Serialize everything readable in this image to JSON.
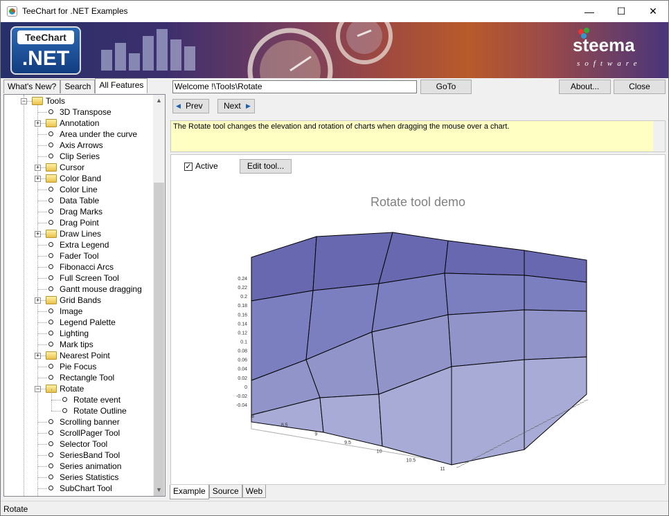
{
  "window": {
    "title": "TeeChart for .NET Examples",
    "controls": {
      "minimize": "—",
      "maximize": "☐",
      "close": "✕"
    }
  },
  "banner": {
    "logo_top": "TeeChart",
    "logo_bottom": ".NET",
    "brand": "steema",
    "brand_sub": "software"
  },
  "left_tabs": [
    {
      "label": "What's New?",
      "active": false
    },
    {
      "label": "Search",
      "active": false
    },
    {
      "label": "All Features",
      "active": true
    }
  ],
  "tree": {
    "items": [
      {
        "label": "Tools",
        "type": "folder-open",
        "level": 0
      },
      {
        "label": "3D Transpose",
        "type": "leaf",
        "level": 1
      },
      {
        "label": "Annotation",
        "type": "folder",
        "level": 1
      },
      {
        "label": "Area under the curve",
        "type": "leaf",
        "level": 1
      },
      {
        "label": "Axis Arrows",
        "type": "leaf",
        "level": 1
      },
      {
        "label": "Clip Series",
        "type": "leaf",
        "level": 1
      },
      {
        "label": "Cursor",
        "type": "folder",
        "level": 1
      },
      {
        "label": "Color Band",
        "type": "folder",
        "level": 1
      },
      {
        "label": "Color Line",
        "type": "leaf",
        "level": 1
      },
      {
        "label": "Data Table",
        "type": "leaf",
        "level": 1
      },
      {
        "label": "Drag Marks",
        "type": "leaf",
        "level": 1
      },
      {
        "label": "Drag Point",
        "type": "leaf",
        "level": 1
      },
      {
        "label": "Draw Lines",
        "type": "folder",
        "level": 1
      },
      {
        "label": "Extra Legend",
        "type": "leaf",
        "level": 1
      },
      {
        "label": "Fader Tool",
        "type": "leaf",
        "level": 1
      },
      {
        "label": "Fibonacci Arcs",
        "type": "leaf",
        "level": 1
      },
      {
        "label": "Full Screen Tool",
        "type": "leaf",
        "level": 1
      },
      {
        "label": "Gantt mouse dragging",
        "type": "leaf",
        "level": 1
      },
      {
        "label": "Grid Bands",
        "type": "folder",
        "level": 1
      },
      {
        "label": "Image",
        "type": "leaf",
        "level": 1
      },
      {
        "label": "Legend Palette",
        "type": "leaf",
        "level": 1
      },
      {
        "label": "Lighting",
        "type": "leaf",
        "level": 1
      },
      {
        "label": "Mark tips",
        "type": "leaf",
        "level": 1
      },
      {
        "label": "Nearest Point",
        "type": "folder",
        "level": 1
      },
      {
        "label": "Pie Focus",
        "type": "leaf",
        "level": 1
      },
      {
        "label": "Rectangle Tool",
        "type": "leaf",
        "level": 1
      },
      {
        "label": "Rotate",
        "type": "folder-open",
        "level": 1
      },
      {
        "label": "Rotate event",
        "type": "leaf",
        "level": 2
      },
      {
        "label": "Rotate Outline",
        "type": "leaf",
        "level": 2
      },
      {
        "label": "Scrolling banner",
        "type": "leaf",
        "level": 1
      },
      {
        "label": "ScrollPager Tool",
        "type": "leaf",
        "level": 1
      },
      {
        "label": "Selector Tool",
        "type": "leaf",
        "level": 1
      },
      {
        "label": "SeriesBand Tool",
        "type": "leaf",
        "level": 1
      },
      {
        "label": "Series animation",
        "type": "leaf",
        "level": 1
      },
      {
        "label": "Series Statistics",
        "type": "leaf",
        "level": 1
      },
      {
        "label": "SubChart Tool",
        "type": "leaf",
        "level": 1
      }
    ]
  },
  "toolbar": {
    "path_value": "Welcome !\\Tools\\Rotate",
    "goto_label": "GoTo",
    "about_label": "About...",
    "close_label": "Close",
    "prev_label": "Prev",
    "next_label": "Next"
  },
  "description": "The Rotate tool changes the elevation and rotation of charts when dragging the mouse over a chart.",
  "example": {
    "active_label": "Active",
    "active_checked": true,
    "edit_tool_label": "Edit tool...",
    "chart_title": "Rotate tool demo"
  },
  "chart_data": {
    "type": "surface-3d",
    "title": "Rotate tool demo",
    "y_ticks": [
      "0.24",
      "0.22",
      "0.2",
      "0.18",
      "0.16",
      "0.14",
      "0.12",
      "0.1",
      "0.08",
      "0.06",
      "0.04",
      "0.02",
      "0",
      "-0.02",
      "-0.04"
    ],
    "x_ticks": [
      "8",
      "8.5",
      "9",
      "9.5",
      "10",
      "10.5",
      "11"
    ],
    "fill_colors": [
      "#6868b0",
      "#7b7fbf",
      "#9094c8",
      "#a7abd6",
      "#babee2"
    ]
  },
  "bottom_tabs": [
    {
      "label": "Example",
      "active": true
    },
    {
      "label": "Source",
      "active": false
    },
    {
      "label": "Web",
      "active": false
    }
  ],
  "status": {
    "text": "Rotate"
  }
}
